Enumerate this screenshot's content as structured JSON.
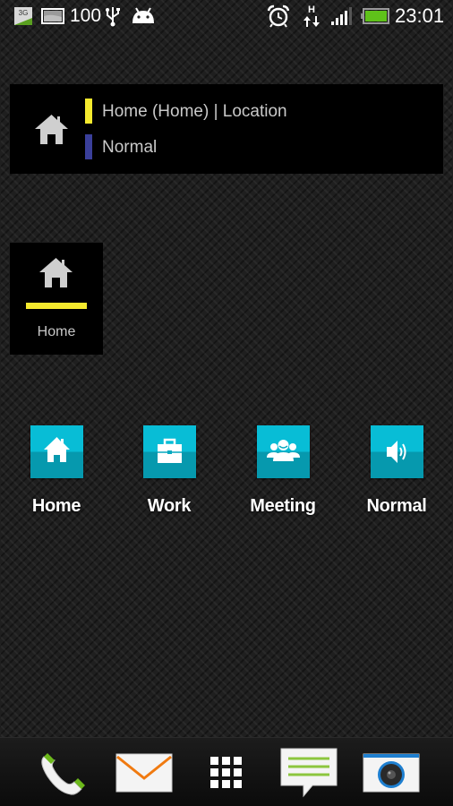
{
  "status_bar": {
    "network_type": "3G",
    "battery_percent_text": "100",
    "time": "23:01",
    "data_type": "H",
    "signal_level": 0.8,
    "battery_level": 1.0,
    "icons": [
      "3g-icon",
      "image-icon",
      "usb-icon",
      "android-icon",
      "alarm-icon",
      "data-hspa-icon",
      "signal-icon",
      "battery-icon"
    ]
  },
  "profile_widget_wide": {
    "line1": "Home  (Home) | Location",
    "line2": "Normal",
    "line1_color": "#f5ea2e",
    "line2_color": "#3a3f9a",
    "icon": "house-icon"
  },
  "profile_widget_small": {
    "label": "Home",
    "indicator_color": "#f5ea2e",
    "icon": "house-icon"
  },
  "shortcuts": [
    {
      "label": "Home",
      "icon": "house-icon"
    },
    {
      "label": "Work",
      "icon": "briefcase-icon"
    },
    {
      "label": "Meeting",
      "icon": "people-icon"
    },
    {
      "label": "Normal",
      "icon": "speaker-icon"
    }
  ],
  "dock": {
    "items": [
      "phone-icon",
      "mail-icon",
      "app-drawer-icon",
      "messages-icon",
      "camera-icon"
    ]
  },
  "colors": {
    "tile_top": "#08bdd6",
    "tile_bottom": "#0699ae"
  }
}
